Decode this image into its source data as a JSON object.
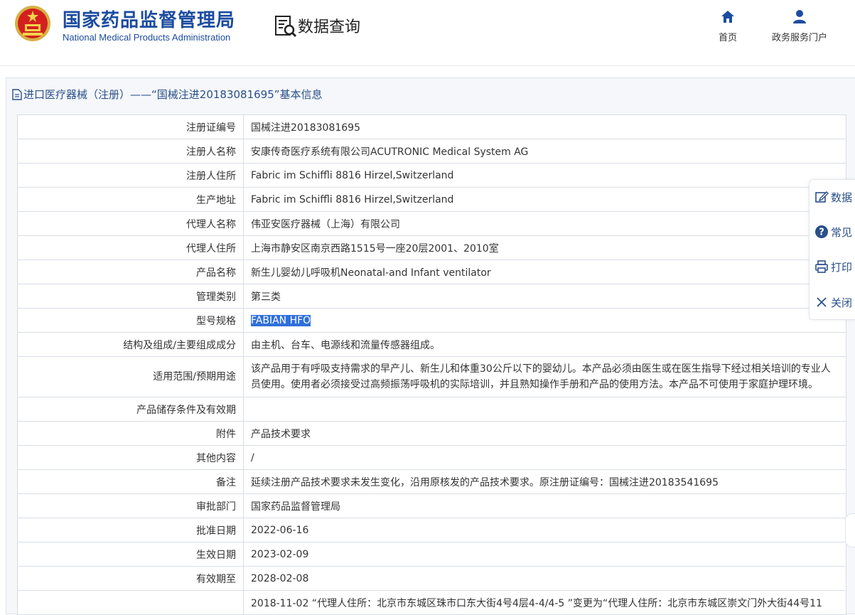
{
  "header": {
    "brand_cn": "国家药品监督管理局",
    "brand_en": "National Medical Products Administration",
    "query_title": "数据查询",
    "nav": [
      {
        "label": "首页",
        "icon": "home-icon"
      },
      {
        "label": "政务服务门户",
        "icon": "user-icon"
      }
    ],
    "brand_color": "#1c4ca0"
  },
  "breadcrumb": "进口医疗器械（注册）——“国械注进20183081695”基本信息",
  "rows": [
    {
      "key": "注册证编号",
      "value": "国械注进20183081695"
    },
    {
      "key": "注册人名称",
      "value": "安康传奇医疗系统有限公司ACUTRONIC Medical System AG"
    },
    {
      "key": "注册人住所",
      "value": "Fabric im Schiffli 8816 Hirzel,Switzerland"
    },
    {
      "key": "生产地址",
      "value": "Fabric im Schiffli 8816 Hirzel,Switzerland"
    },
    {
      "key": "代理人名称",
      "value": "伟亚安医疗器械（上海）有限公司"
    },
    {
      "key": "代理人住所",
      "value": "上海市静安区南京西路1515号一座20层2001、2010室"
    },
    {
      "key": "产品名称",
      "value": "新生儿婴幼儿呼吸机Neonatal-and Infant ventilator"
    },
    {
      "key": "管理类别",
      "value": "第三类"
    },
    {
      "key": "型号规格",
      "value": "FABIAN HFO"
    },
    {
      "key": "结构及组成/主要组成成分",
      "value": "由主机、台车、电源线和流量传感器组成。"
    },
    {
      "key": "适用范围/预期用途",
      "value": "该产品用于有呼吸支持需求的早产儿、新生儿和体重30公斤以下的婴幼儿。本产品必须由医生或在医生指导下经过相关培训的专业人员使用。使用者必须接受过高频振荡呼吸机的实际培训，并且熟知操作手册和产品的使用方法。本产品不可使用于家庭护理环境。"
    },
    {
      "key": "产品储存条件及有效期",
      "value": ""
    },
    {
      "key": "附件",
      "value": "产品技术要求"
    },
    {
      "key": "其他内容",
      "value": "/"
    },
    {
      "key": "备注",
      "value": "延续注册产品技术要求未发生变化，沿用原核发的产品技术要求。原注册证编号：国械注进20183541695"
    },
    {
      "key": "审批部门",
      "value": "国家药品监督管理局"
    },
    {
      "key": "批准日期",
      "value": "2022-06-16"
    },
    {
      "key": "生效日期",
      "value": "2023-02-09"
    },
    {
      "key": "有效期至",
      "value": "2028-02-08"
    },
    {
      "key": "",
      "value": "2018-11-02 “代理人住所：北京市东城区珠市口东大街4号4层4-4/4-5 ”变更为“代理人住所：北京市东城区崇文门外大街44号11"
    }
  ],
  "sidebar": [
    {
      "label": "数据",
      "icon": "edit-icon"
    },
    {
      "label": "常见",
      "icon": "help-icon"
    },
    {
      "label": "打印",
      "icon": "print-icon"
    },
    {
      "label": "关闭",
      "icon": "close-icon"
    }
  ]
}
